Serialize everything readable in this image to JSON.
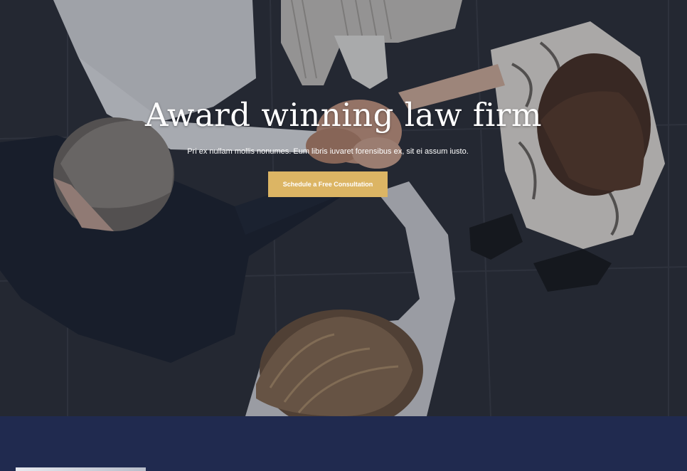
{
  "hero": {
    "title": "Award winning law firm",
    "subtitle": "Pri ex nullam mollis nonumes. Eum libris iuvaret forensibus ex, sit ei assum iusto.",
    "cta_label": "Schedule a Free Consultation",
    "photo_description_icon": "team-hands-together-photo"
  },
  "colors": {
    "accent": "#dcb564",
    "band_background": "#202a4f",
    "title_text": "#ffffff"
  }
}
